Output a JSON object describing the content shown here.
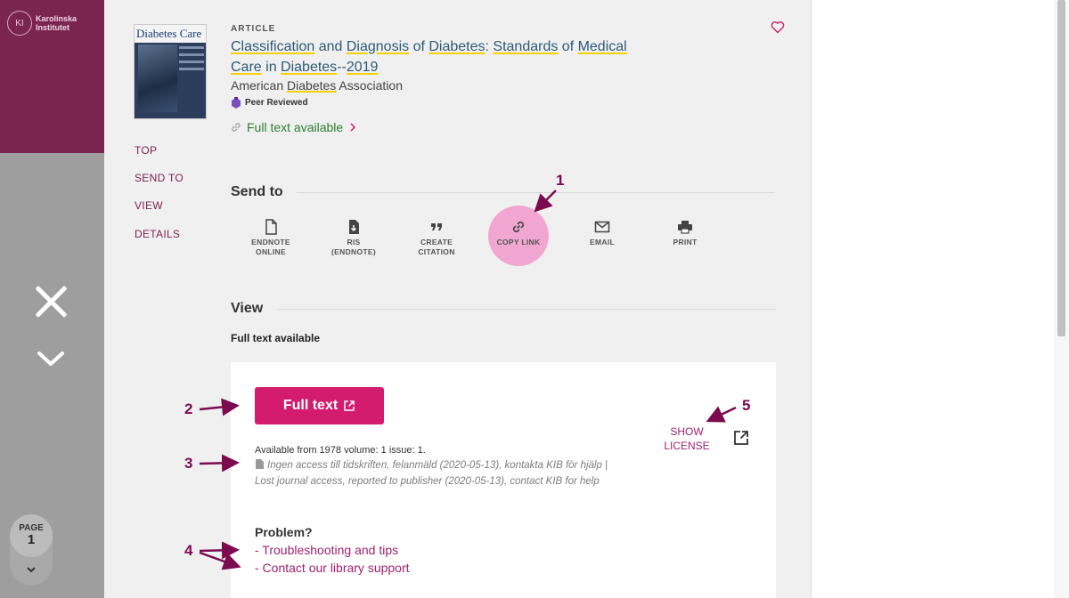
{
  "institution": {
    "name": "Karolinska Institutet",
    "seal_text": "KI"
  },
  "overlay": {
    "page_label": "PAGE",
    "page_number": "1"
  },
  "cover": {
    "title": "Diabetes Care"
  },
  "side_nav": [
    "TOP",
    "SEND TO",
    "VIEW",
    "DETAILS"
  ],
  "record": {
    "type": "ARTICLE",
    "title_parts": [
      "Classification",
      " and ",
      "Diagnosis",
      " of ",
      "Diabetes",
      ": ",
      "Standards",
      " of ",
      "Medical",
      " ",
      "Care",
      " in ",
      "Diabetes",
      "--",
      "2019"
    ],
    "author_parts": [
      "American ",
      "Diabetes",
      " Association"
    ],
    "peer_reviewed": "Peer Reviewed",
    "availability_link": "Full text available"
  },
  "send_to": {
    "title": "Send to",
    "actions": [
      {
        "line1": "ENDNOTE",
        "line2": "ONLINE",
        "icon": "document-icon"
      },
      {
        "line1": "RIS",
        "line2": "(ENDNOTE)",
        "icon": "document-download-icon"
      },
      {
        "line1": "CREATE",
        "line2": "CITATION",
        "icon": "quote-icon"
      },
      {
        "line1": "COPY LINK",
        "line2": "",
        "icon": "link-icon"
      },
      {
        "line1": "EMAIL",
        "line2": "",
        "icon": "envelope-icon"
      },
      {
        "line1": "PRINT",
        "line2": "",
        "icon": "printer-icon"
      }
    ]
  },
  "view": {
    "title": "View",
    "full_text_available": "Full text available",
    "full_text_button": "Full text",
    "availability": "Available from 1978 volume: 1 issue: 1.",
    "note": "Ingen access till tidskriften, felanmäld (2020-05-13), kontakta KIB för hjälp | Lost journal access, reported to publisher (2020-05-13), contact KIB for help",
    "problem_title": "Problem?",
    "problem_links": [
      "- Troubleshooting and tips",
      "- Contact our library support"
    ],
    "show_license": "SHOW LICENSE"
  },
  "annotations": [
    "1",
    "2",
    "3",
    "4",
    "5"
  ],
  "colors": {
    "accent": "#d41c6f",
    "brand": "#7a2450",
    "link": "#2f5a74",
    "available": "#2e7d32",
    "highlight": "#f5d000",
    "annotation": "#7c0a4e"
  }
}
